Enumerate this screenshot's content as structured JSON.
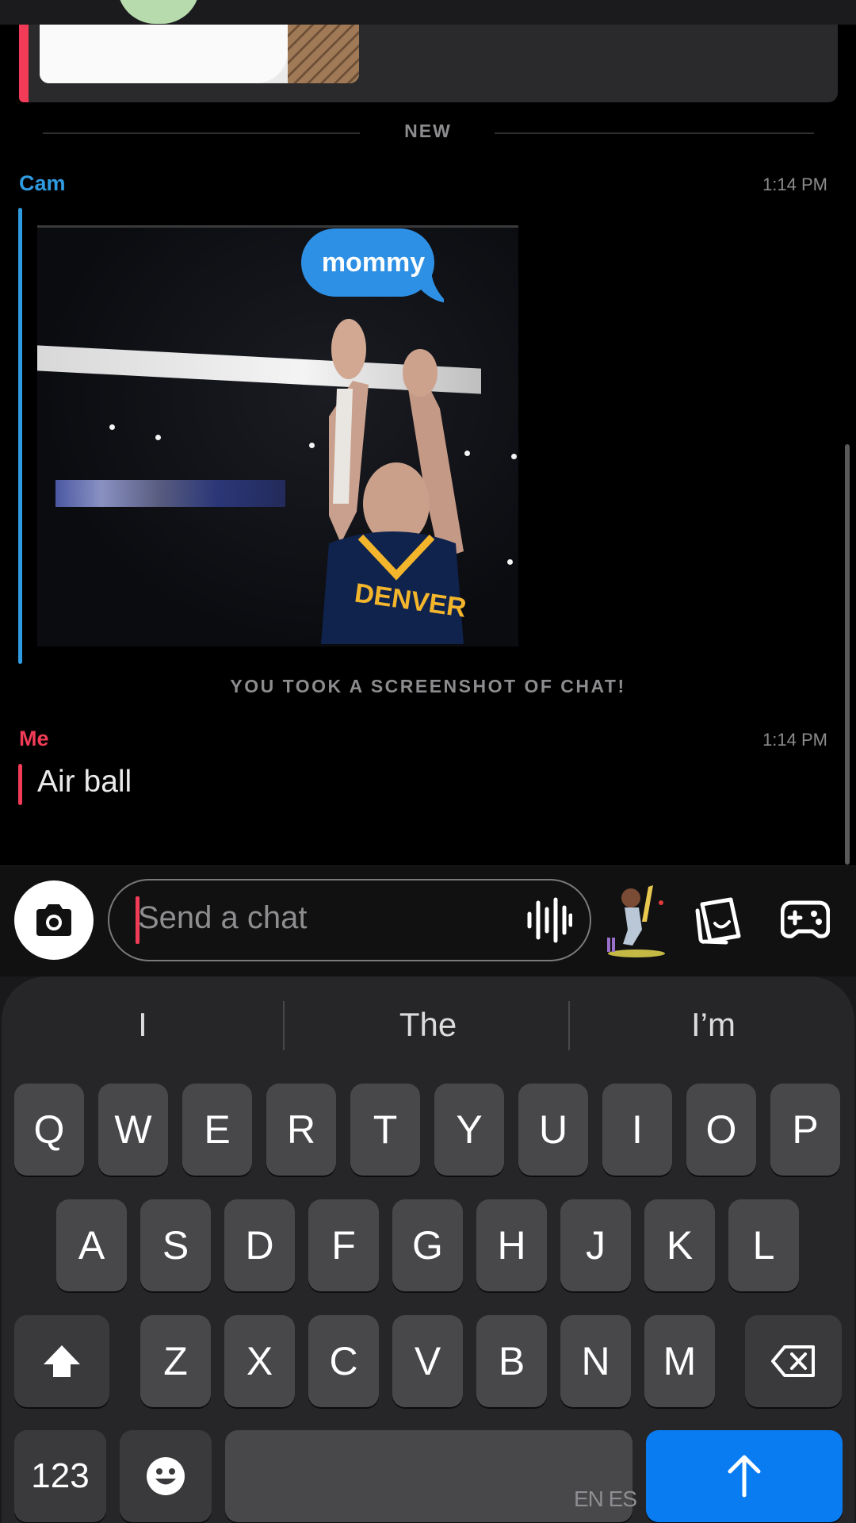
{
  "divider": {
    "new_label": "NEW"
  },
  "messages": {
    "cam": {
      "sender": "Cam",
      "time": "1:14 PM",
      "meme_caption": "mommy",
      "jersey_text": "DENVER"
    },
    "notice": "YOU TOOK A SCREENSHOT OF CHAT!",
    "me": {
      "sender": "Me",
      "time": "1:14 PM",
      "text": "Air ball"
    }
  },
  "colors": {
    "cam": "#2f9be0",
    "me": "#f23c57",
    "accent_blue": "#0a7cf2",
    "background": "#000000"
  },
  "composer": {
    "placeholder": "Send a chat",
    "icons": [
      "camera-icon",
      "voice-waveform-icon",
      "bitmoji-avatar",
      "sticker-icon",
      "game-controller-icon"
    ]
  },
  "keyboard": {
    "suggestions": [
      "I",
      "The",
      "I’m"
    ],
    "row1": [
      "Q",
      "W",
      "E",
      "R",
      "T",
      "Y",
      "U",
      "I",
      "O",
      "P"
    ],
    "row2": [
      "A",
      "S",
      "D",
      "F",
      "G",
      "H",
      "J",
      "K",
      "L"
    ],
    "row3": [
      "Z",
      "X",
      "C",
      "V",
      "B",
      "N",
      "M"
    ],
    "numbers_key": "123",
    "language_label": "EN ES",
    "icons": [
      "shift-icon",
      "backspace-icon",
      "emoji-icon",
      "send-arrow-icon"
    ]
  }
}
